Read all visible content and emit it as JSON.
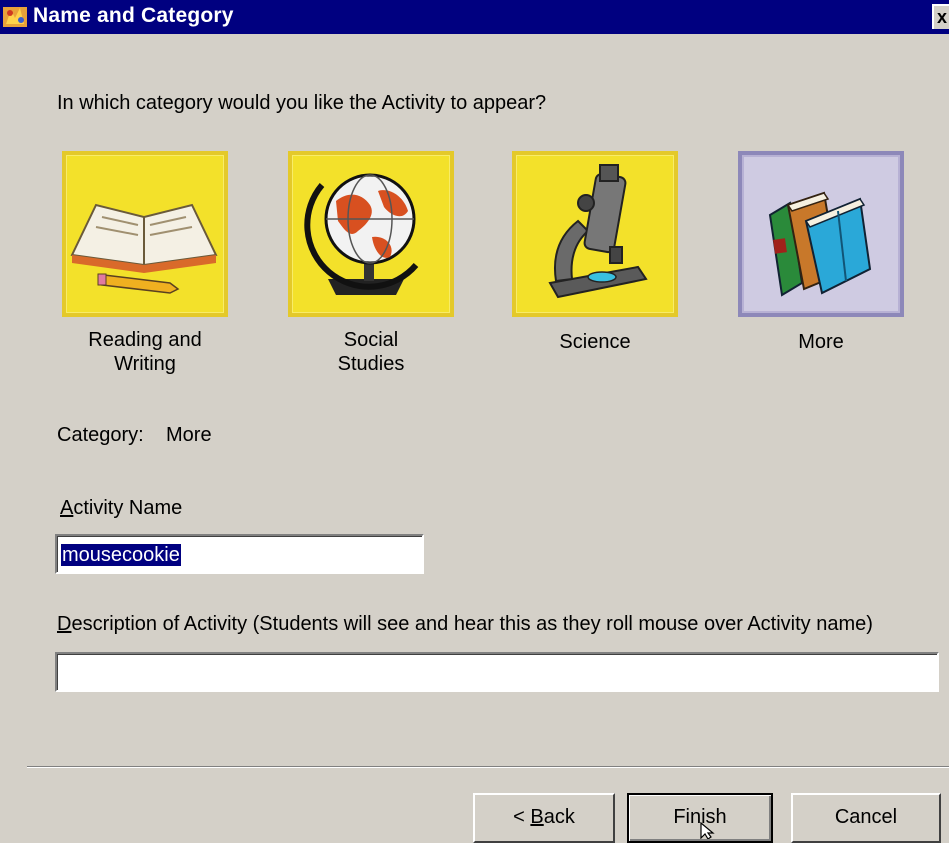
{
  "window": {
    "title": "Name and Category",
    "close_glyph": "x"
  },
  "prompt": "In which category would you like the Activity to appear?",
  "categories": [
    {
      "label": "Reading and\nWriting",
      "icon": "open-book-pencil-icon",
      "selected": false
    },
    {
      "label": "Social\nStudies",
      "icon": "globe-icon",
      "selected": false
    },
    {
      "label": "Science",
      "icon": "microscope-icon",
      "selected": false
    },
    {
      "label": "More",
      "icon": "books-icon",
      "selected": true
    }
  ],
  "category_label": "Category:",
  "category_value": "More",
  "activity_name": {
    "label_first": "A",
    "label_rest": "ctivity Name",
    "value": "mousecookie"
  },
  "description": {
    "label_first": "D",
    "label_rest": "escription of Activity (Students will see and hear this as they roll mouse over Activity name)",
    "value": ""
  },
  "buttons": {
    "back_prefix": "< ",
    "back_u": "B",
    "back_rest": "ack",
    "finish": "Finish",
    "cancel": "Cancel"
  },
  "colors": {
    "tile_yellow": "#f3e12a",
    "tile_selected": "#cfcbe2",
    "titlebar": "#000080"
  }
}
